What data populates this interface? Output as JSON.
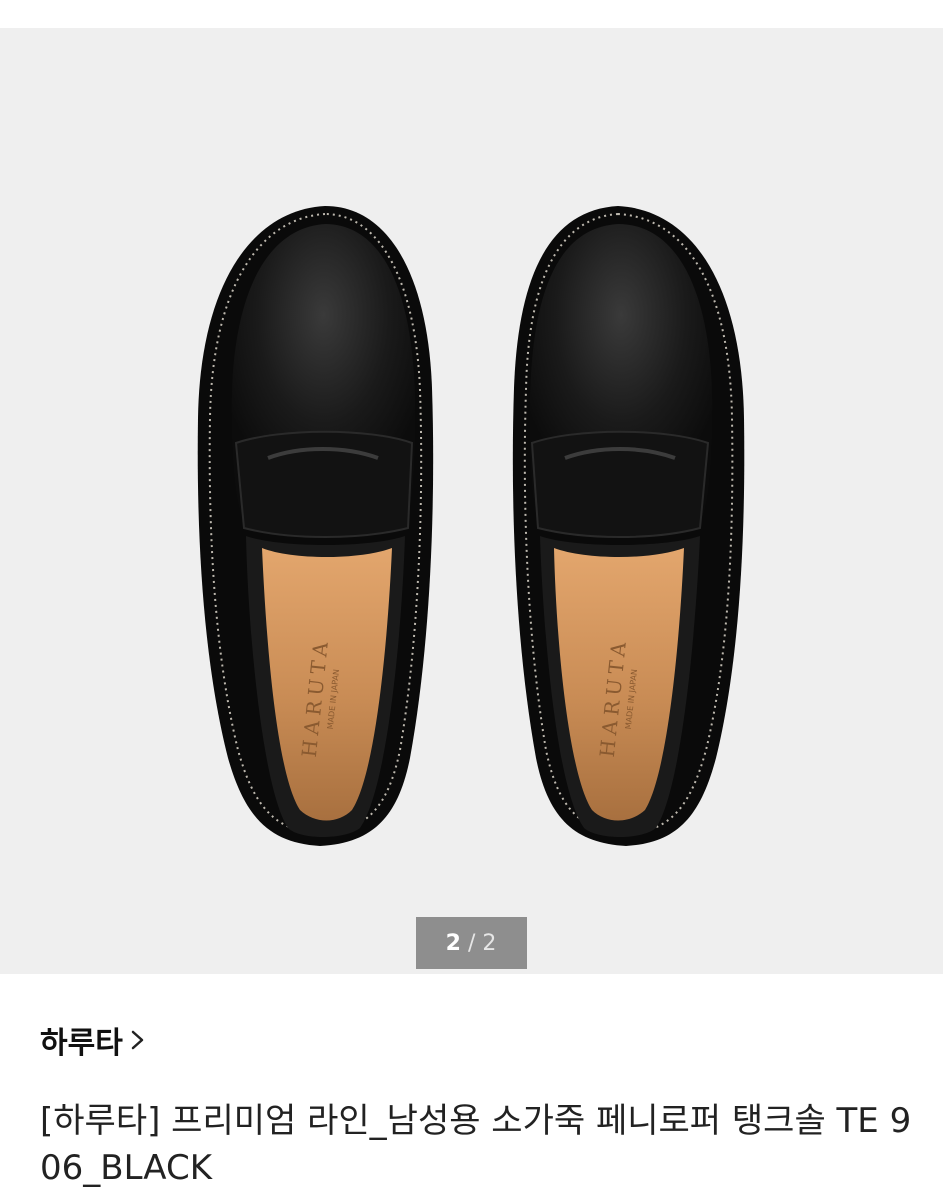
{
  "gallery": {
    "image_alt": "Black leather penny loafers, top view",
    "insole_text": "HARUTA",
    "insole_subtext": "MADE IN JAPAN",
    "counter": {
      "current": "2",
      "separator": "/",
      "total": "2"
    }
  },
  "product": {
    "brand": "하루타",
    "title": "[하루타] 프리미엄 라인_남성용 소가죽 페니로퍼 탱크솔 TE 906_BLACK"
  },
  "colors": {
    "gallery_bg": "#efefef",
    "counter_bg": "#8e8e8e",
    "leather": "#141414",
    "insole": "#c98c55"
  }
}
